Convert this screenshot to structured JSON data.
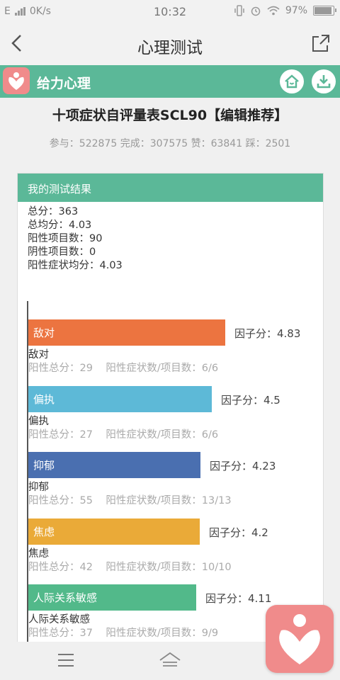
{
  "status": {
    "carrier": "E",
    "speed": "0K/s",
    "time": "10:32",
    "battery": "97%"
  },
  "nav": {
    "back_icon": "chevron-left-icon",
    "title": "心理测试",
    "share_icon": "share-icon"
  },
  "brand": {
    "name": "给力心理",
    "color": "#5bb898",
    "logo_color": "#f08b8b"
  },
  "test": {
    "title": "十项症状自评量表SCL90【编辑推荐】",
    "stats": "参与：522875 完成：307575 赞：63841 踩：2501"
  },
  "result": {
    "header": "我的测试结果",
    "summary": [
      "总分：363",
      "总均分：4.03",
      "阳性项目数：90",
      "阴性项目数：0",
      "阳性症状均分：4.03"
    ]
  },
  "chart_data": {
    "type": "bar",
    "orientation": "horizontal",
    "categories": [
      "敌对",
      "偏执",
      "抑郁",
      "焦虑",
      "人际关系敏感"
    ],
    "values": [
      4.83,
      4.5,
      4.23,
      4.2,
      4.11
    ],
    "score_labels": [
      "因子分：4.83",
      "因子分：4.5",
      "因子分：4.23",
      "因子分：4.2",
      "因子分：4.11"
    ],
    "details": [
      "阳性总分：29    阳性症状数/项目数：6/6",
      "阳性总分：27    阳性症状数/项目数：6/6",
      "阳性总分：55    阳性症状数/项目数：13/13",
      "阳性总分：42    阳性症状数/项目数：10/10",
      "阳性总分：37    阳性症状数/项目数：9/9"
    ],
    "colors": [
      "#ec7440",
      "#5db9d7",
      "#4a6fb0",
      "#eaaa38",
      "#52b98a"
    ],
    "xlim": [
      0,
      5
    ]
  }
}
